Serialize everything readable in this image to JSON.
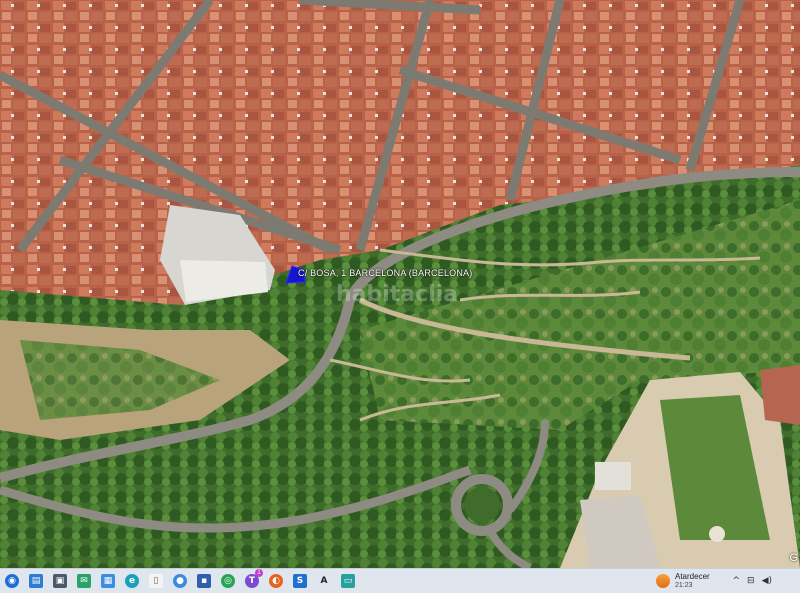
{
  "map": {
    "parcel_label": "C/ BOSA, 1 BARCELONA (BARCELONA)",
    "watermark": "habitaclia",
    "corner_mark": "G"
  },
  "taskbar": {
    "icons": [
      "start-icon",
      "file-explorer-icon",
      "store-icon",
      "mail-icon",
      "photos-icon",
      "edge-icon",
      "documents-icon",
      "folder-icon",
      "save-icon",
      "chrome-icon",
      "teams-icon",
      "firefox-icon",
      "app-s-icon",
      "app-a-icon",
      "app-window-icon"
    ],
    "weather": {
      "title": "Atardecer",
      "time": "21:23"
    },
    "tray": {
      "chevron": "^",
      "network": "⊟",
      "volume": "◀)"
    }
  }
}
